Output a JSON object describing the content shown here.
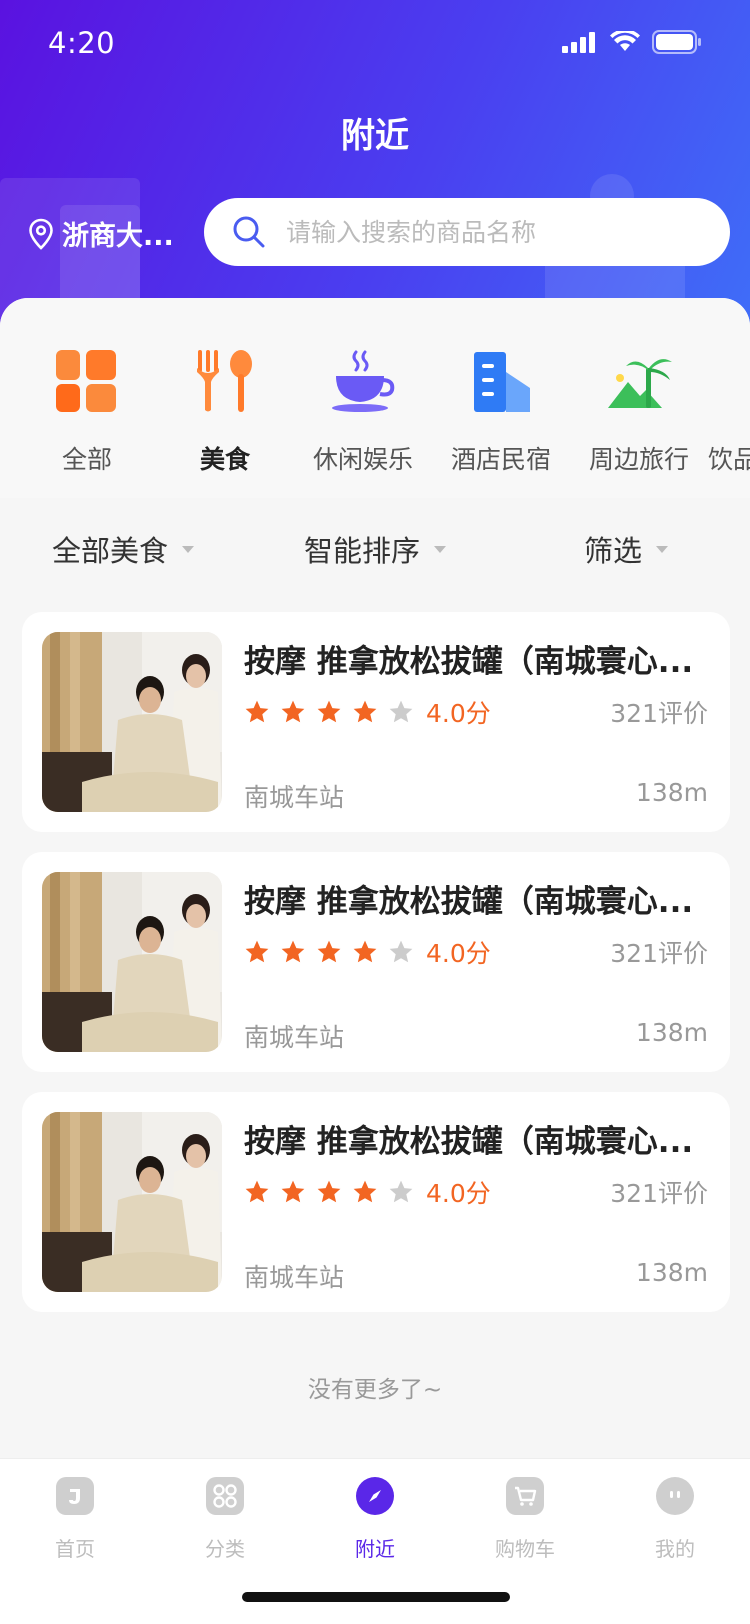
{
  "status_bar": {
    "time": "4:20"
  },
  "header": {
    "title": "附近",
    "location": "浙商大...",
    "search_placeholder": "请输入搜索的商品名称"
  },
  "categories": [
    {
      "label": "全部",
      "icon": "grid-icon",
      "active": false
    },
    {
      "label": "美食",
      "icon": "fork-spoon-icon",
      "active": true
    },
    {
      "label": "休闲娱乐",
      "icon": "coffee-cup-icon",
      "active": false
    },
    {
      "label": "酒店民宿",
      "icon": "building-icon",
      "active": false
    },
    {
      "label": "周边旅行",
      "icon": "palm-tree-icon",
      "active": false
    },
    {
      "label": "饮品",
      "icon": "drink-icon",
      "active": false
    }
  ],
  "filters": {
    "category": "全部美食",
    "sort": "智能排序",
    "filter": "筛选"
  },
  "listings": [
    {
      "title": "按摩 推拿放松拔罐（南城寰心...",
      "rating": 4,
      "score": "4.0分",
      "reviews": "321评价",
      "station": "南城车站",
      "distance": "138m"
    },
    {
      "title": "按摩 推拿放松拔罐（南城寰心...",
      "rating": 4,
      "score": "4.0分",
      "reviews": "321评价",
      "station": "南城车站",
      "distance": "138m"
    },
    {
      "title": "按摩 推拿放松拔罐（南城寰心...",
      "rating": 4,
      "score": "4.0分",
      "reviews": "321评价",
      "station": "南城车站",
      "distance": "138m"
    }
  ],
  "no_more_text": "没有更多了~",
  "tabs": [
    {
      "label": "首页",
      "icon": "home-icon",
      "active": false
    },
    {
      "label": "分类",
      "icon": "category-icon",
      "active": false
    },
    {
      "label": "附近",
      "icon": "compass-icon",
      "active": true
    },
    {
      "label": "购物车",
      "icon": "cart-icon",
      "active": false
    },
    {
      "label": "我的",
      "icon": "profile-icon",
      "active": false
    }
  ],
  "colors": {
    "primary": "#5a27e8",
    "star": "#f26522",
    "star_empty": "#cccccc"
  }
}
